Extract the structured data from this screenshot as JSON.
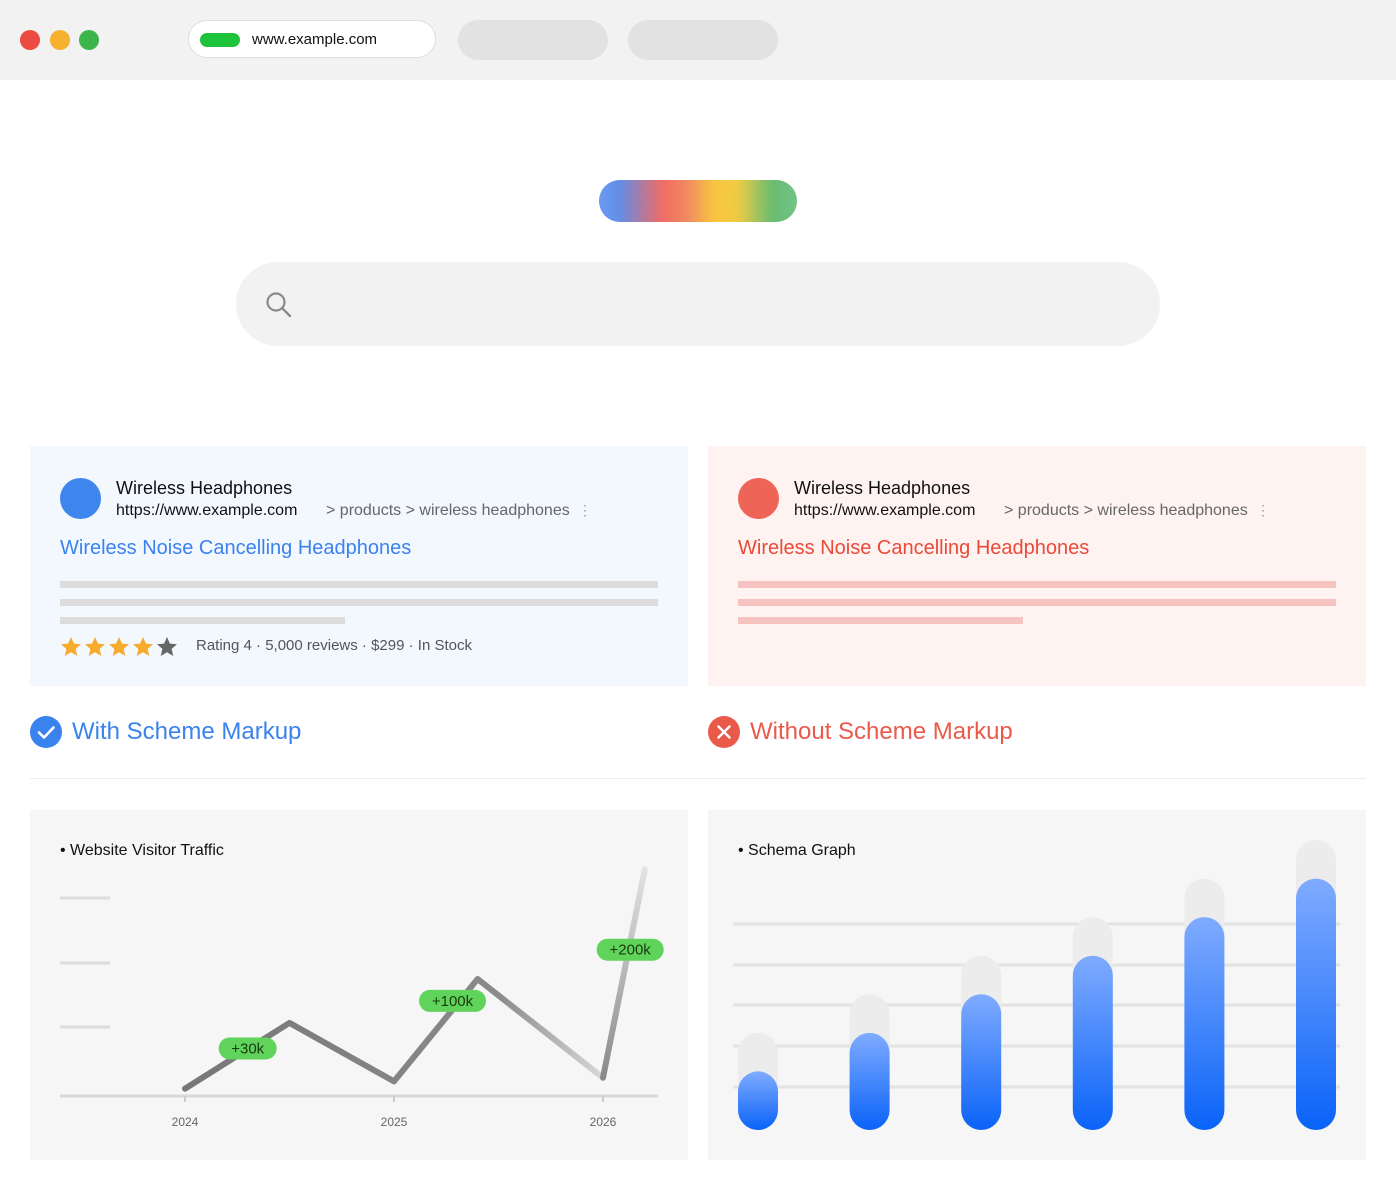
{
  "browser": {
    "url": "www.example.com",
    "window_dots": [
      "#ec4b41",
      "#f5b12f",
      "#3cb54a"
    ]
  },
  "logo": {
    "colors": [
      "#5e8eea",
      "#f26b63",
      "#f8c63e",
      "#63bb72"
    ]
  },
  "search": {
    "value": "",
    "icon": "search-icon"
  },
  "result_with_markup": {
    "site_name": "Wireless Headphones",
    "url": "https://www.example.com",
    "breadcrumb": "> products > wireless headphones",
    "more": "⋮",
    "title": "Wireless Noise Cancelling Headphones",
    "rating_stars": 4,
    "rating_max": 5,
    "meta": "Rating 4 · 5,000 reviews · $299 · In Stock",
    "accent": "#3a82ee"
  },
  "result_without_markup": {
    "site_name": "Wireless Headphones",
    "url": "https://www.example.com",
    "breadcrumb": "> products > wireless headphones",
    "more": "⋮",
    "title": "Wireless Noise Cancelling Headphones",
    "accent": "#ea4a38"
  },
  "captions": {
    "with": {
      "label": "With Scheme Markup",
      "icon": "check-circle-icon",
      "color": "#3a82ee"
    },
    "without": {
      "label": "Without Scheme Markup",
      "icon": "x-circle-icon",
      "color": "#ea5a4a"
    }
  },
  "chart_data": [
    {
      "type": "line",
      "title": "• Website Visitor Traffic",
      "x_ticks": [
        "2024",
        "2025",
        "2026"
      ],
      "x": [
        2024,
        2024.5,
        2025,
        2025.4,
        2026,
        2026.2
      ],
      "values": [
        10,
        100,
        20,
        160,
        25,
        310
      ],
      "ylim": [
        0,
        350
      ],
      "annotations": [
        {
          "label": "+30k",
          "x": 2024.3,
          "y": 65
        },
        {
          "label": "+100k",
          "x": 2025.28,
          "y": 130
        },
        {
          "label": "+200k",
          "x": 2026.13,
          "y": 200
        }
      ],
      "grid": false
    },
    {
      "type": "bar",
      "title": "• Schema Graph",
      "values": [
        1,
        2,
        3,
        4,
        5,
        6
      ],
      "ylim": [
        0,
        7
      ],
      "grid": true,
      "color": "#1b6dfa"
    }
  ]
}
